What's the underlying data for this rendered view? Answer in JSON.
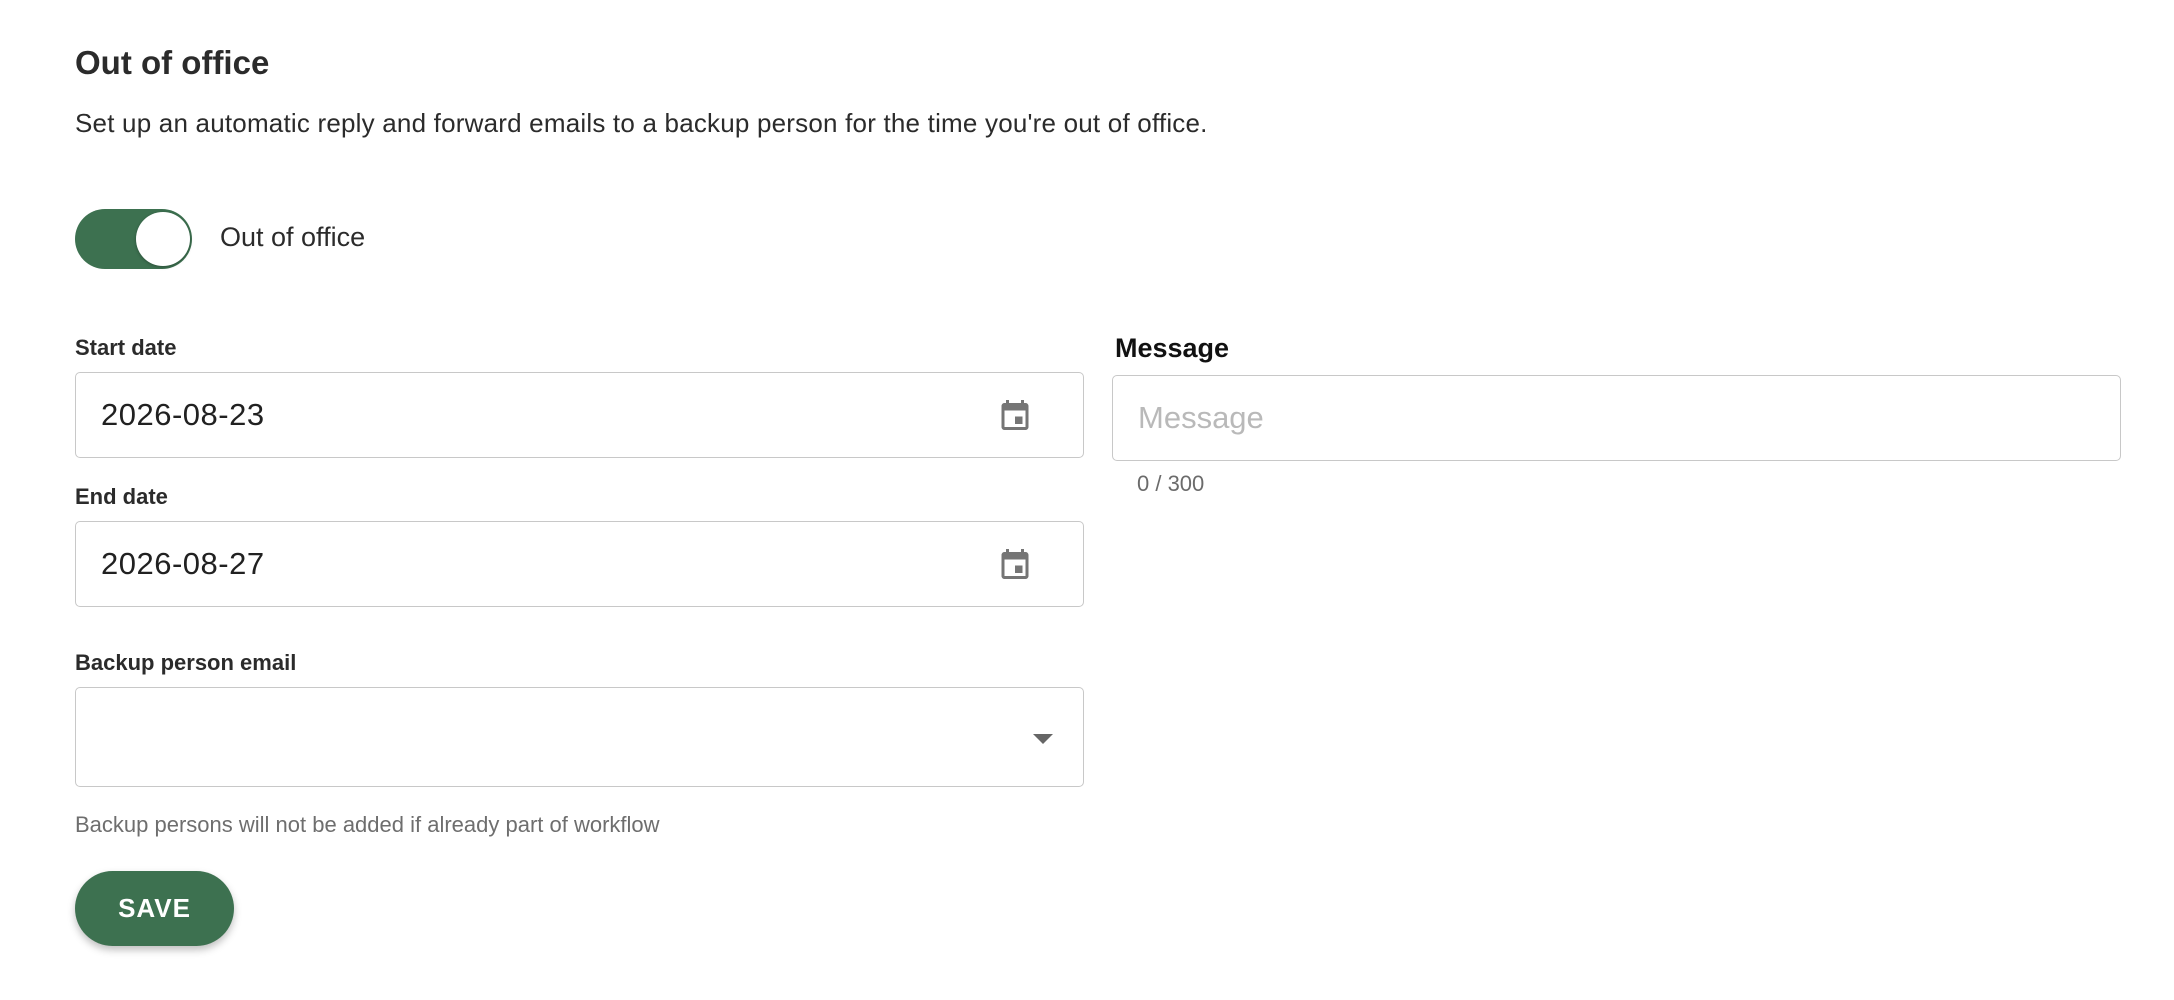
{
  "header": {
    "title": "Out of office",
    "subtitle": "Set up an automatic reply and forward emails to a backup person for the time you're out of office."
  },
  "toggle": {
    "label": "Out of office",
    "on": true,
    "color": "#3d7150"
  },
  "start_date": {
    "label": "Start date",
    "value": "2026-08-23",
    "icon": "calendar-icon"
  },
  "end_date": {
    "label": "End date",
    "value": "2026-08-27",
    "icon": "calendar-icon"
  },
  "backup": {
    "label": "Backup person email",
    "value": "",
    "icon": "chevron-down-icon",
    "helper": "Backup persons will not be added if already part of workflow"
  },
  "message": {
    "label": "Message",
    "placeholder": "Message",
    "counter": "0 / 300"
  },
  "save": {
    "label": "SAVE"
  }
}
